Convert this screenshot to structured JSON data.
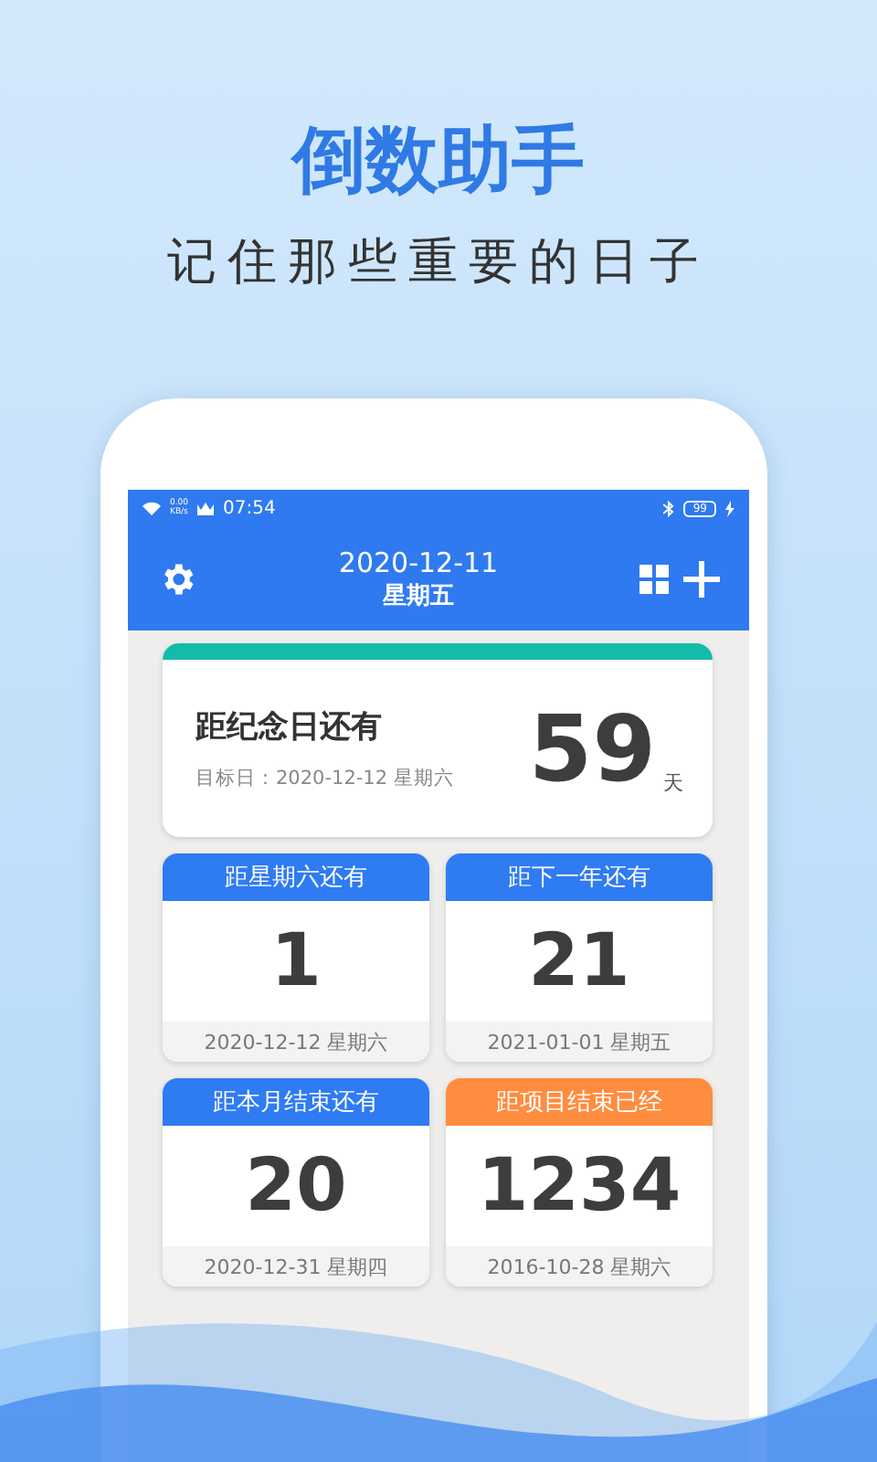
{
  "headline": "倒数助手",
  "tagline": "记住那些重要的日子",
  "status_bar": {
    "net_speed": "0.00",
    "net_unit": "KB/s",
    "time": "07:54",
    "battery": "99"
  },
  "header": {
    "date": "2020-12-11",
    "weekday": "星期五"
  },
  "featured": {
    "title": "距纪念日还有",
    "target": "目标日：2020-12-12 星期六",
    "count": "59",
    "unit": "天",
    "color": "#12bca9"
  },
  "cards": [
    {
      "title": "距星期六还有",
      "count": "1",
      "date": "2020-12-12 星期六",
      "color": "#2f7bf2"
    },
    {
      "title": "距下一年还有",
      "count": "21",
      "date": "2021-01-01 星期五",
      "color": "#2f7bf2"
    },
    {
      "title": "距本月结束还有",
      "count": "20",
      "date": "2020-12-31 星期四",
      "color": "#2f7bf2"
    },
    {
      "title": "距项目结束已经",
      "count": "1234",
      "date": "2016-10-28 星期六",
      "color": "#ff8c3f"
    }
  ]
}
